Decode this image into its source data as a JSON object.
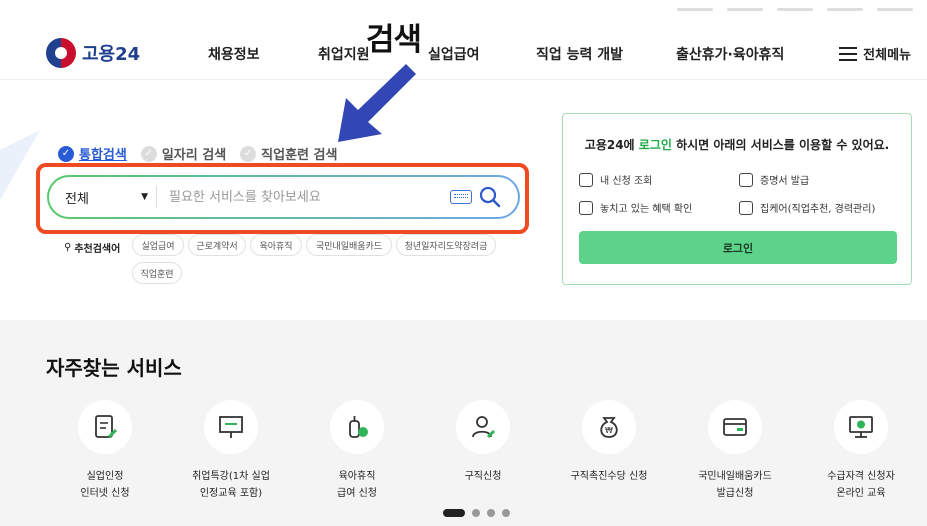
{
  "header": {
    "logo_text": "고용24",
    "nav": [
      "채용정보",
      "취업지원",
      "실업급여",
      "직업 능력 개발",
      "출산휴가·육아휴직"
    ],
    "menu_all": "전체메뉴"
  },
  "annotation": {
    "text": "검색",
    "arrow_color": "#3346b5",
    "highlight_color": "#f04a23"
  },
  "search": {
    "tabs": [
      "통합검색",
      "일자리 검색",
      "직업훈련 검색"
    ],
    "active_tab": 0,
    "select_value": "전체",
    "placeholder": "필요한 서비스를 찾아보세요",
    "recommend_label": "추천검색어",
    "chips": [
      "실업급여",
      "근로계약서",
      "육아휴직",
      "국민내일배움카드",
      "청년일자리도약장려금",
      "직업훈련"
    ]
  },
  "login_panel": {
    "msg_pre": "고용24에 ",
    "msg_hl": "로그인",
    "msg_post": " 하시면 아래의 서비스를 이용할 수 있어요.",
    "services": [
      "내 신청 조회",
      "증명서 발급",
      "놓치고 있는 혜택 확인",
      "집케어(직업추천, 경력관리)"
    ],
    "button": "로그인",
    "accent": "#5dd38a"
  },
  "frequent": {
    "title": "자주찾는 서비스",
    "items": [
      {
        "label": "실업인정\n인터넷 신청",
        "icon": "document-pen-icon"
      },
      {
        "label": "취업특강(1차 실업\n인정교육 포함)",
        "icon": "presentation-board-icon"
      },
      {
        "label": "육아휴직\n급여 신청",
        "icon": "baby-bottle-icon"
      },
      {
        "label": "구직신청",
        "icon": "person-pen-icon"
      },
      {
        "label": "구직촉진수당 신청",
        "icon": "money-bag-icon"
      },
      {
        "label": "국민내일배움카드\n발급신청",
        "icon": "card-icon"
      },
      {
        "label": "수급자격 신청자\n온라인 교육",
        "icon": "monitor-play-icon"
      }
    ],
    "pagination": {
      "pages": 4,
      "current": 1
    }
  }
}
